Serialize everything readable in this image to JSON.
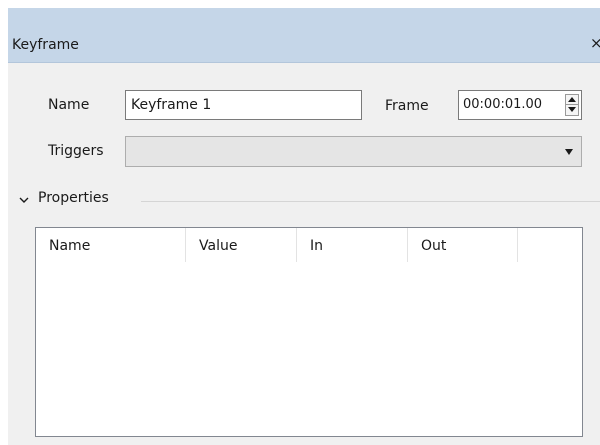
{
  "window": {
    "title": "Keyframe",
    "close_glyph": "×",
    "close_icon": "close-icon"
  },
  "form": {
    "name_label": "Name",
    "name_value": "Keyframe 1",
    "frame_label": "Frame",
    "frame_value": "00:00:01.00",
    "triggers_label": "Triggers",
    "triggers_value": ""
  },
  "properties": {
    "section_label": "Properties",
    "expanded": true,
    "columns": [
      "Name",
      "Value",
      "In",
      "Out",
      ""
    ],
    "rows": []
  },
  "colors": {
    "titlebar": "#c5d6e8",
    "dialog_background": "#f0f0f0",
    "combo_disabled": "#e5e5e5"
  }
}
